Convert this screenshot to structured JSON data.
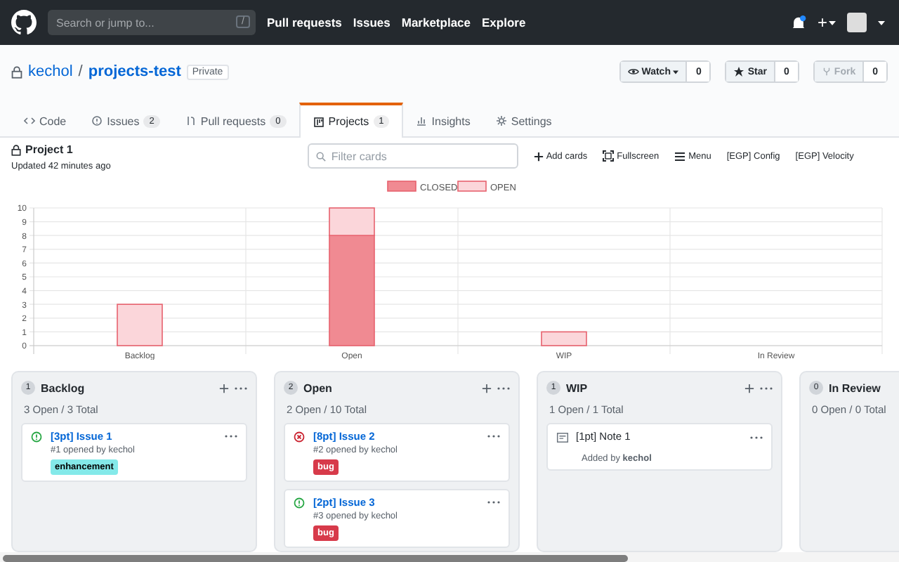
{
  "top_nav": {
    "search": {
      "placeholder": "Search or jump to..."
    },
    "slash_key": "/",
    "links": [
      "Pull requests",
      "Issues",
      "Marketplace",
      "Explore"
    ],
    "plus": "+",
    "notification_unread": true
  },
  "repo": {
    "owner": "kechol",
    "separator": "/",
    "name": "projects-test",
    "visibility": "Private",
    "actions": [
      {
        "kind": "watch",
        "label": "Watch",
        "count": "0",
        "disabled": false
      },
      {
        "kind": "star",
        "label": "Star",
        "count": "0",
        "disabled": false
      },
      {
        "kind": "fork",
        "label": "Fork",
        "count": "0",
        "disabled": true
      }
    ]
  },
  "tabs": [
    {
      "kind": "code",
      "label": "Code",
      "selected": false
    },
    {
      "kind": "issues",
      "label": "Issues",
      "count": "2",
      "selected": false
    },
    {
      "kind": "pulls",
      "label": "Pull requests",
      "count": "0",
      "selected": false
    },
    {
      "kind": "projects",
      "label": "Projects",
      "count": "1",
      "selected": true
    },
    {
      "kind": "insights",
      "label": "Insights",
      "selected": false
    },
    {
      "kind": "settings",
      "label": "Settings",
      "selected": false
    }
  ],
  "project": {
    "title": "Project 1",
    "updated": "Updated 42 minutes ago",
    "filter": {
      "placeholder": "Filter cards"
    },
    "tools": [
      {
        "kind": "add",
        "label": "Add cards"
      },
      {
        "kind": "fullscreen",
        "label": "Fullscreen"
      },
      {
        "kind": "menu",
        "label": "Menu"
      },
      {
        "kind": "text",
        "label": "[EGP] Config"
      },
      {
        "kind": "text",
        "label": "[EGP] Velocity"
      }
    ],
    "chart_data": {
      "type": "bar",
      "categories": [
        "Backlog",
        "Open",
        "WIP",
        "In Review"
      ],
      "series": [
        {
          "name": "CLOSED",
          "color": "#f08a92",
          "values": [
            0,
            8,
            0,
            0
          ]
        },
        {
          "name": "OPEN",
          "color": "#fbd6da",
          "values": [
            3,
            2,
            1,
            0
          ]
        }
      ],
      "ylim": [
        0,
        10
      ],
      "yticks": [
        0,
        1,
        2,
        3,
        4,
        5,
        6,
        7,
        8,
        9,
        10
      ],
      "stacked": true,
      "grid": true,
      "legend": true
    }
  },
  "columns": [
    {
      "count": "1",
      "name": "Backlog",
      "summary": "3 Open / 3 Total",
      "cards": [
        {
          "kind": "issue",
          "closed": false,
          "title": "[3pt] Issue 1",
          "meta": "#1 opened by kechol",
          "labels": [
            {
              "name": "enhancement",
              "color": "#84e9e9"
            }
          ]
        }
      ]
    },
    {
      "count": "2",
      "name": "Open",
      "summary": "2 Open / 10 Total",
      "cards": [
        {
          "kind": "issue",
          "closed": true,
          "title": "[8pt] Issue 2",
          "meta": "#2 opened by kechol",
          "labels": [
            {
              "name": "bug",
              "color": "#d73a4a"
            }
          ]
        },
        {
          "kind": "issue",
          "closed": false,
          "title": "[2pt] Issue 3",
          "meta": "#3 opened by kechol",
          "labels": [
            {
              "name": "bug",
              "color": "#d73a4a"
            }
          ]
        }
      ]
    },
    {
      "count": "1",
      "name": "WIP",
      "summary": "1 Open / 1 Total",
      "cards": [
        {
          "kind": "note",
          "title": "[1pt] Note 1",
          "meta": "Added by **kechol**"
        }
      ]
    },
    {
      "count": "0",
      "name": "In Review",
      "summary": "0 Open / 0 Total"
    }
  ]
}
